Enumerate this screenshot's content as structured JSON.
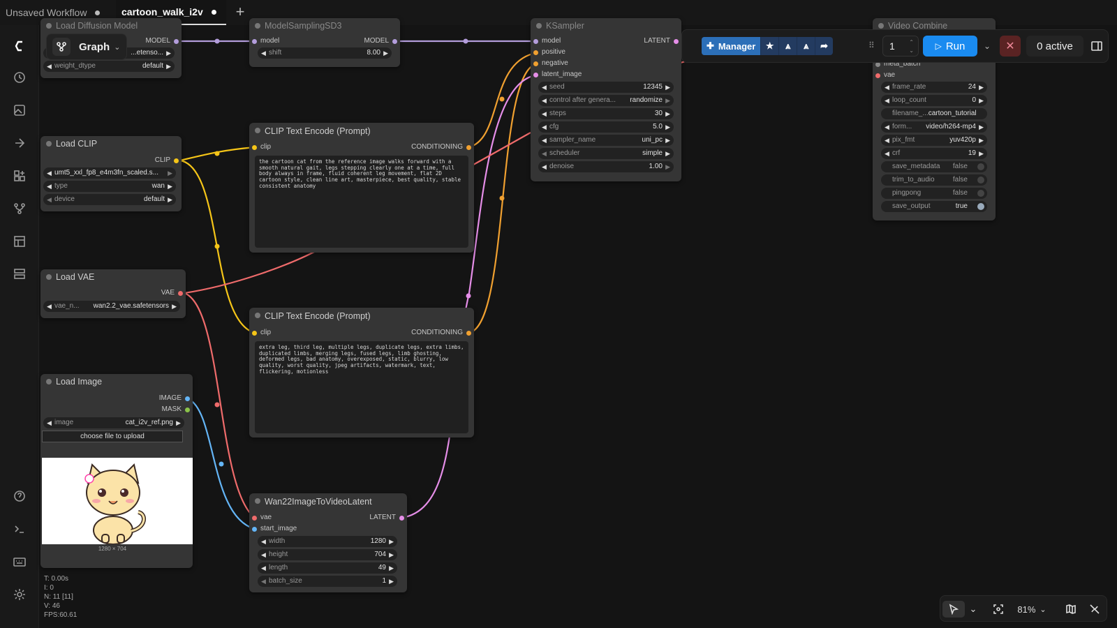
{
  "tabs": [
    {
      "label": "Unsaved Workflow"
    },
    {
      "label": "cartoon_walk_i2v"
    }
  ],
  "graph_menu": {
    "label": "Graph"
  },
  "toolbar": {
    "manager_label": "Manager",
    "queue_count": "1",
    "run_label": "Run",
    "active_label": "0 active"
  },
  "nodes": {
    "load_diffusion": {
      "title": "Load Diffusion Model",
      "out_model": "MODEL",
      "unet_name": {
        "label": "unet_name",
        "value": "...etenso..."
      },
      "weight_dtype": {
        "label": "weight_dtype",
        "value": "default"
      }
    },
    "model_sampling": {
      "title": "ModelSamplingSD3",
      "in_model": "model",
      "out_model": "MODEL",
      "shift": {
        "label": "shift",
        "value": "8.00"
      }
    },
    "ksampler": {
      "title": "KSampler",
      "in_model": "model",
      "in_positive": "positive",
      "in_negative": "negative",
      "in_latent": "latent_image",
      "out_latent": "LATENT",
      "seed": {
        "label": "seed",
        "value": "12345"
      },
      "control": {
        "label": "control after genera...",
        "value": "randomize"
      },
      "steps": {
        "label": "steps",
        "value": "30"
      },
      "cfg": {
        "label": "cfg",
        "value": "5.0"
      },
      "sampler": {
        "label": "sampler_name",
        "value": "uni_pc"
      },
      "scheduler": {
        "label": "scheduler",
        "value": "simple"
      },
      "denoise": {
        "label": "denoise",
        "value": "1.00"
      }
    },
    "load_clip": {
      "title": "Load CLIP",
      "out_clip": "CLIP",
      "clip_name": {
        "value": "umt5_xxl_fp8_e4m3fn_scaled.s..."
      },
      "type": {
        "label": "type",
        "value": "wan"
      },
      "device": {
        "label": "device",
        "value": "default"
      }
    },
    "clip_pos": {
      "title": "CLIP Text Encode (Prompt)",
      "in_clip": "clip",
      "out_cond": "CONDITIONING",
      "text": "the cartoon cat from the reference image walks forward with a smooth natural gait, legs stepping clearly one at a time, full body always in frame, fluid coherent leg movement, flat 2D cartoon style, clean line art, masterpiece, best quality, stable consistent anatomy"
    },
    "clip_neg": {
      "title": "CLIP Text Encode (Prompt)",
      "in_clip": "clip",
      "out_cond": "CONDITIONING",
      "text": "extra leg, third leg, multiple legs, duplicate legs, extra limbs, duplicated limbs, merging legs, fused legs, limb ghosting, deformed legs, bad anatomy, overexposed, static, blurry, low quality, worst quality, jpeg artifacts, watermark, text, flickering, motionless"
    },
    "load_vae": {
      "title": "Load VAE",
      "out_vae": "VAE",
      "vae_name": {
        "label": "vae_n...",
        "value": "wan2.2_vae.safetensors"
      }
    },
    "load_image": {
      "title": "Load Image",
      "out_image": "IMAGE",
      "out_mask": "MASK",
      "image": {
        "label": "image",
        "value": "cat_i2v_ref.png"
      },
      "upload_label": "choose file to upload",
      "dims": "1280 × 704"
    },
    "wan_latent": {
      "title": "Wan22ImageToVideoLatent",
      "in_vae": "vae",
      "in_start": "start_image",
      "out_latent": "LATENT",
      "width": {
        "label": "width",
        "value": "1280"
      },
      "height": {
        "label": "height",
        "value": "704"
      },
      "length": {
        "label": "length",
        "value": "49"
      },
      "batch_size": {
        "label": "batch_size",
        "value": "1"
      }
    },
    "video_combine": {
      "title": "Video Combine",
      "in_meta": "meta_batch",
      "in_vae": "vae",
      "frame_rate": {
        "label": "frame_rate",
        "value": "24"
      },
      "loop_count": {
        "label": "loop_count",
        "value": "0"
      },
      "filename": {
        "label": "filename_...",
        "value": "cartoon_tutorial"
      },
      "format": {
        "label": "form...",
        "value": "video/h264-mp4"
      },
      "pix_fmt": {
        "label": "pix_fmt",
        "value": "yuv420p"
      },
      "crf": {
        "label": "crf",
        "value": "19"
      },
      "save_metadata": {
        "label": "save_metadata",
        "value": "false"
      },
      "trim_to_audio": {
        "label": "trim_to_audio",
        "value": "false"
      },
      "pingpong": {
        "label": "pingpong",
        "value": "false"
      },
      "save_output": {
        "label": "save_output",
        "value": "true"
      }
    }
  },
  "stats": {
    "t": "T: 0.00s",
    "i": "I: 0",
    "n": "N: 11 [11]",
    "v": "V: 46",
    "fps": "FPS:60.61"
  },
  "zoom": {
    "label": "81%"
  },
  "colors": {
    "model": "#b39ddb",
    "clip": "#f5c518",
    "conditioning": "#f0a030",
    "vae": "#ef6b6b",
    "latent": "#e58ee8",
    "image": "#64b5f6",
    "mask": "#8bc34a",
    "run": "#1a8bf0"
  }
}
